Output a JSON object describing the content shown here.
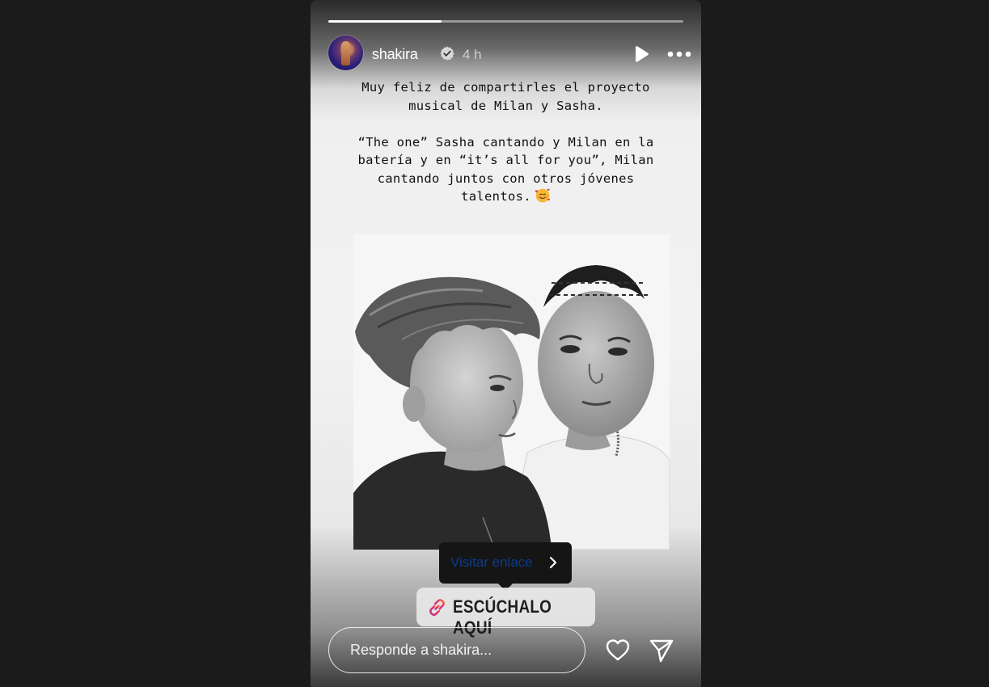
{
  "story": {
    "progress": 0.32,
    "author": {
      "username": "shakira",
      "verified": true,
      "time": "4 h"
    },
    "caption": {
      "paragraph1_lines": [
        "Muy feliz de compartirles el proyecto",
        "musical de Milan y Sasha."
      ],
      "paragraph2_lines": [
        "“The one” Sasha cantando y Milan en la",
        "batería y en “it’s all for you”, Milan",
        "cantando juntos con otros jóvenes",
        "talentos."
      ],
      "emoji": "smiling-face-with-hearts"
    },
    "link_tooltip": {
      "label": "Visitar enlace"
    },
    "link_sticker": {
      "label": "ESCÚCHALO AQUÍ"
    },
    "reply": {
      "placeholder": "Responde a shakira..."
    }
  },
  "icons": {
    "verified": "verified-badge-icon",
    "play": "play-icon",
    "more": "more-options-icon",
    "heart": "heart-icon",
    "send": "send-icon",
    "link": "link-icon"
  },
  "colors": {
    "page_background": "#1b1b1b",
    "tooltip_background": "#151515",
    "tooltip_text": "#0b3c8c"
  }
}
